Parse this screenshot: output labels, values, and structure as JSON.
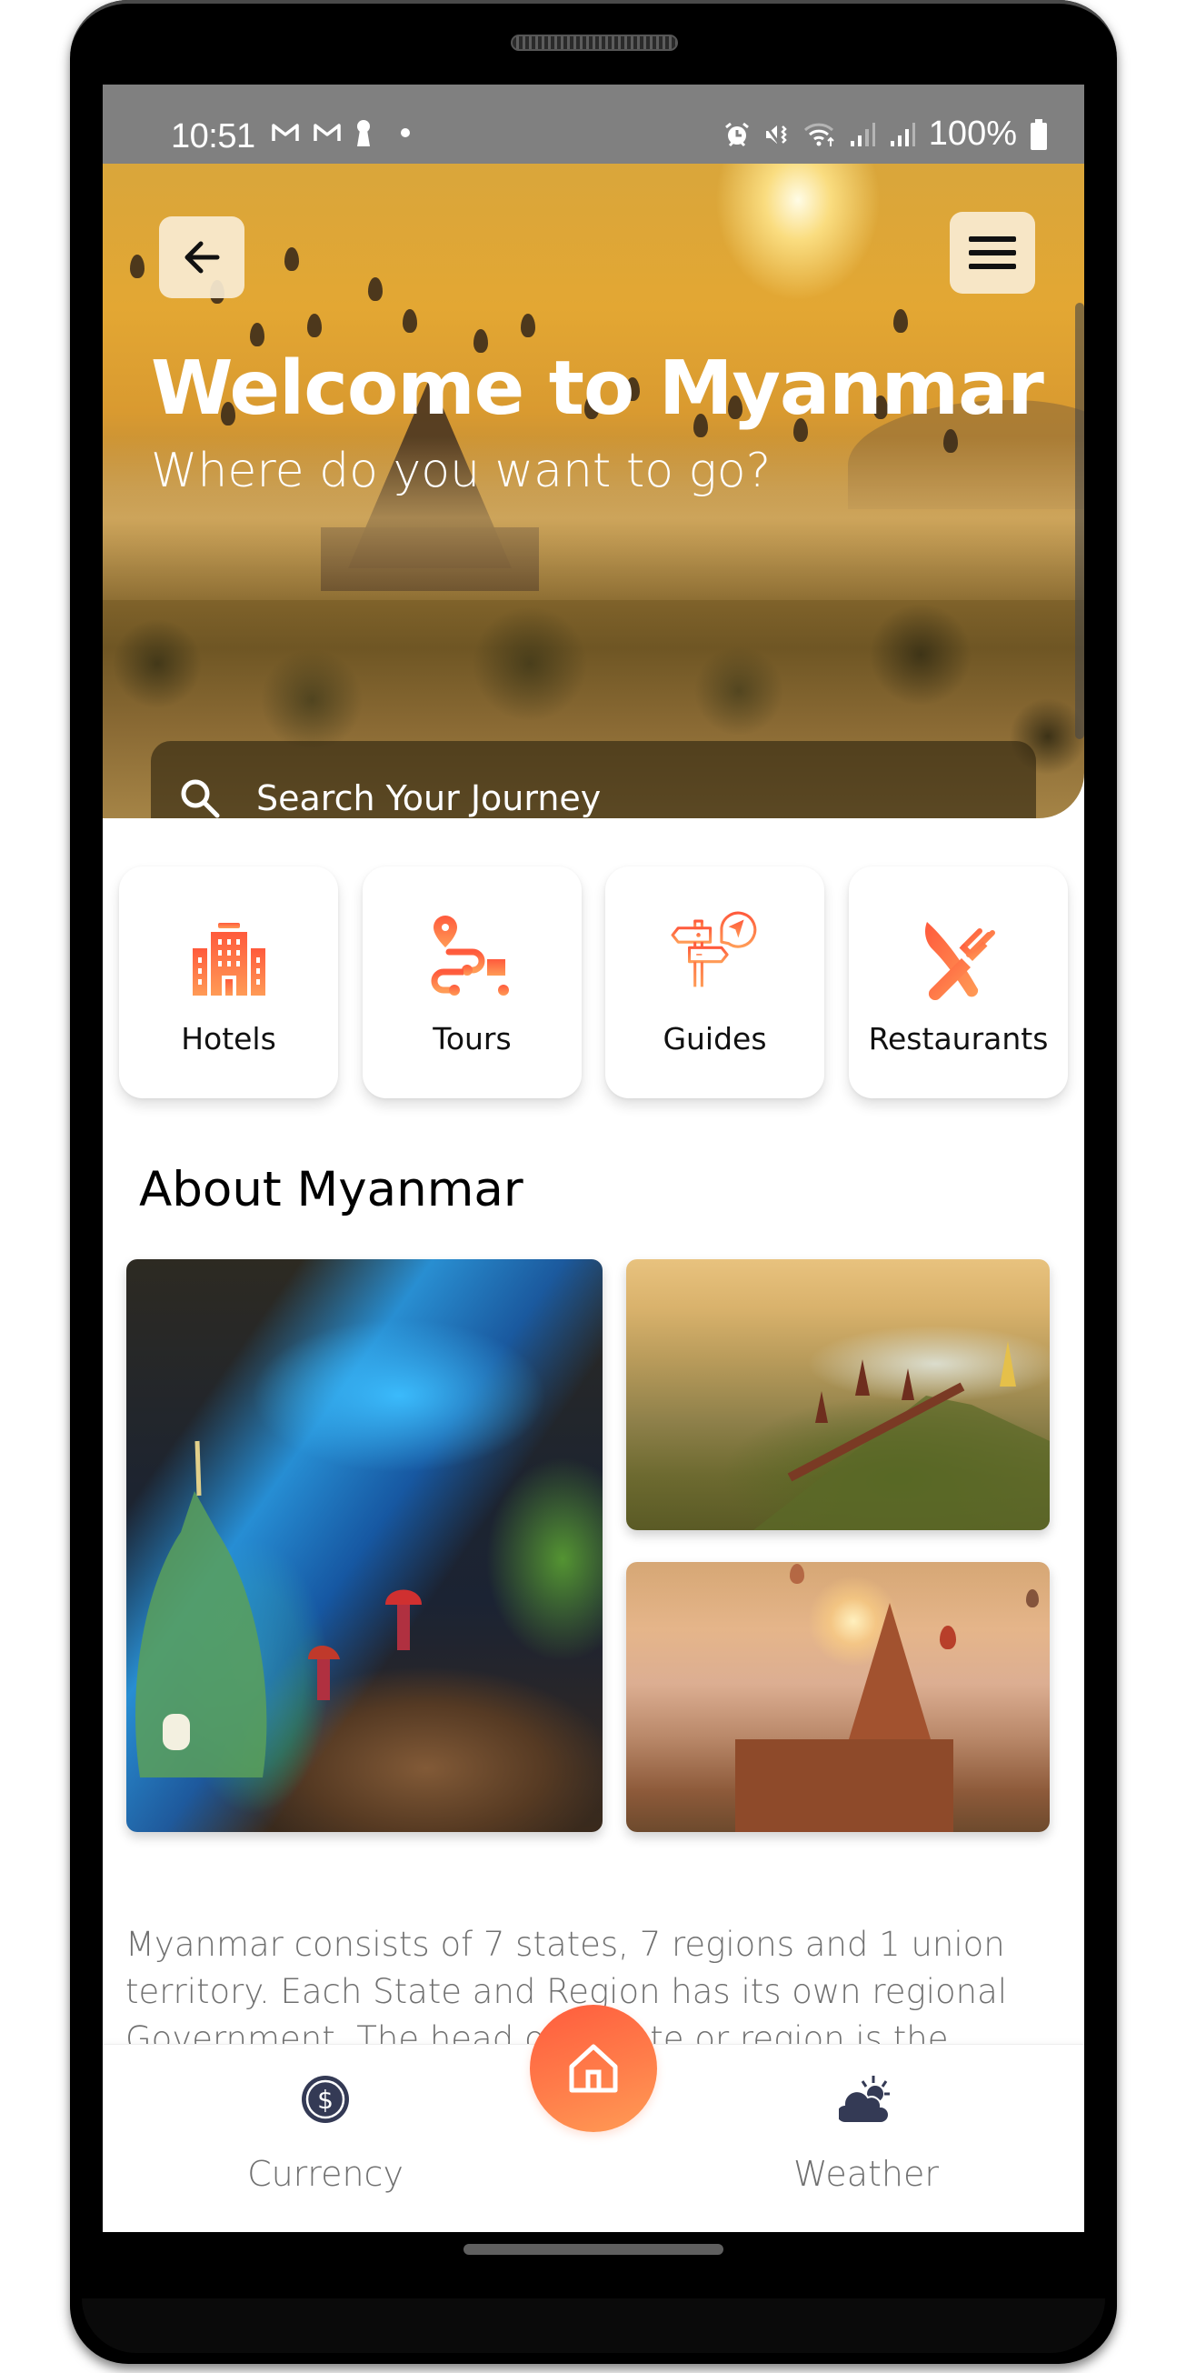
{
  "status_bar": {
    "time": "10:51",
    "left_icons": [
      "gmail-icon",
      "gmail-icon",
      "keyhole-icon",
      "dot-icon"
    ],
    "right_icons": [
      "alarm-icon",
      "mute-vibrate-icon",
      "wifi-icon",
      "signal-icon",
      "signal-icon"
    ],
    "battery_text": "100%"
  },
  "header": {
    "back_icon": "arrow-left-icon",
    "menu_icon": "hamburger-menu-icon",
    "title": "Welcome to Myanmar",
    "subtitle": "Where do you want to go?"
  },
  "search": {
    "placeholder": "Search Your Journey",
    "icon": "search-icon"
  },
  "categories": [
    {
      "label": "Hotels",
      "icon": "hotel-building-icon"
    },
    {
      "label": "Tours",
      "icon": "route-map-icon"
    },
    {
      "label": "Guides",
      "icon": "signpost-icon"
    },
    {
      "label": "Restaurants",
      "icon": "knife-fork-icon"
    }
  ],
  "about": {
    "title": "About Myanmar",
    "photos": [
      {
        "name": "cave-pagoda-photo"
      },
      {
        "name": "mandalay-landscape-photo"
      },
      {
        "name": "bagan-temple-photo"
      }
    ],
    "text": "Myanmar consists of 7 states, 7 regions and 1 union territory. Each State and Region has its own regional Government. The head of a state or region is the"
  },
  "bottom_nav": {
    "items": [
      {
        "label": "Currency",
        "icon": "dollar-coin-icon"
      },
      {
        "label": "",
        "icon": "home-icon"
      },
      {
        "label": "Weather",
        "icon": "cloud-sun-icon"
      }
    ]
  },
  "colors": {
    "accent": "#ff6a44",
    "accent_end": "#ff9c55",
    "nav_icon": "#343a55",
    "status_bar": "#808080",
    "muted_text": "#707070"
  }
}
